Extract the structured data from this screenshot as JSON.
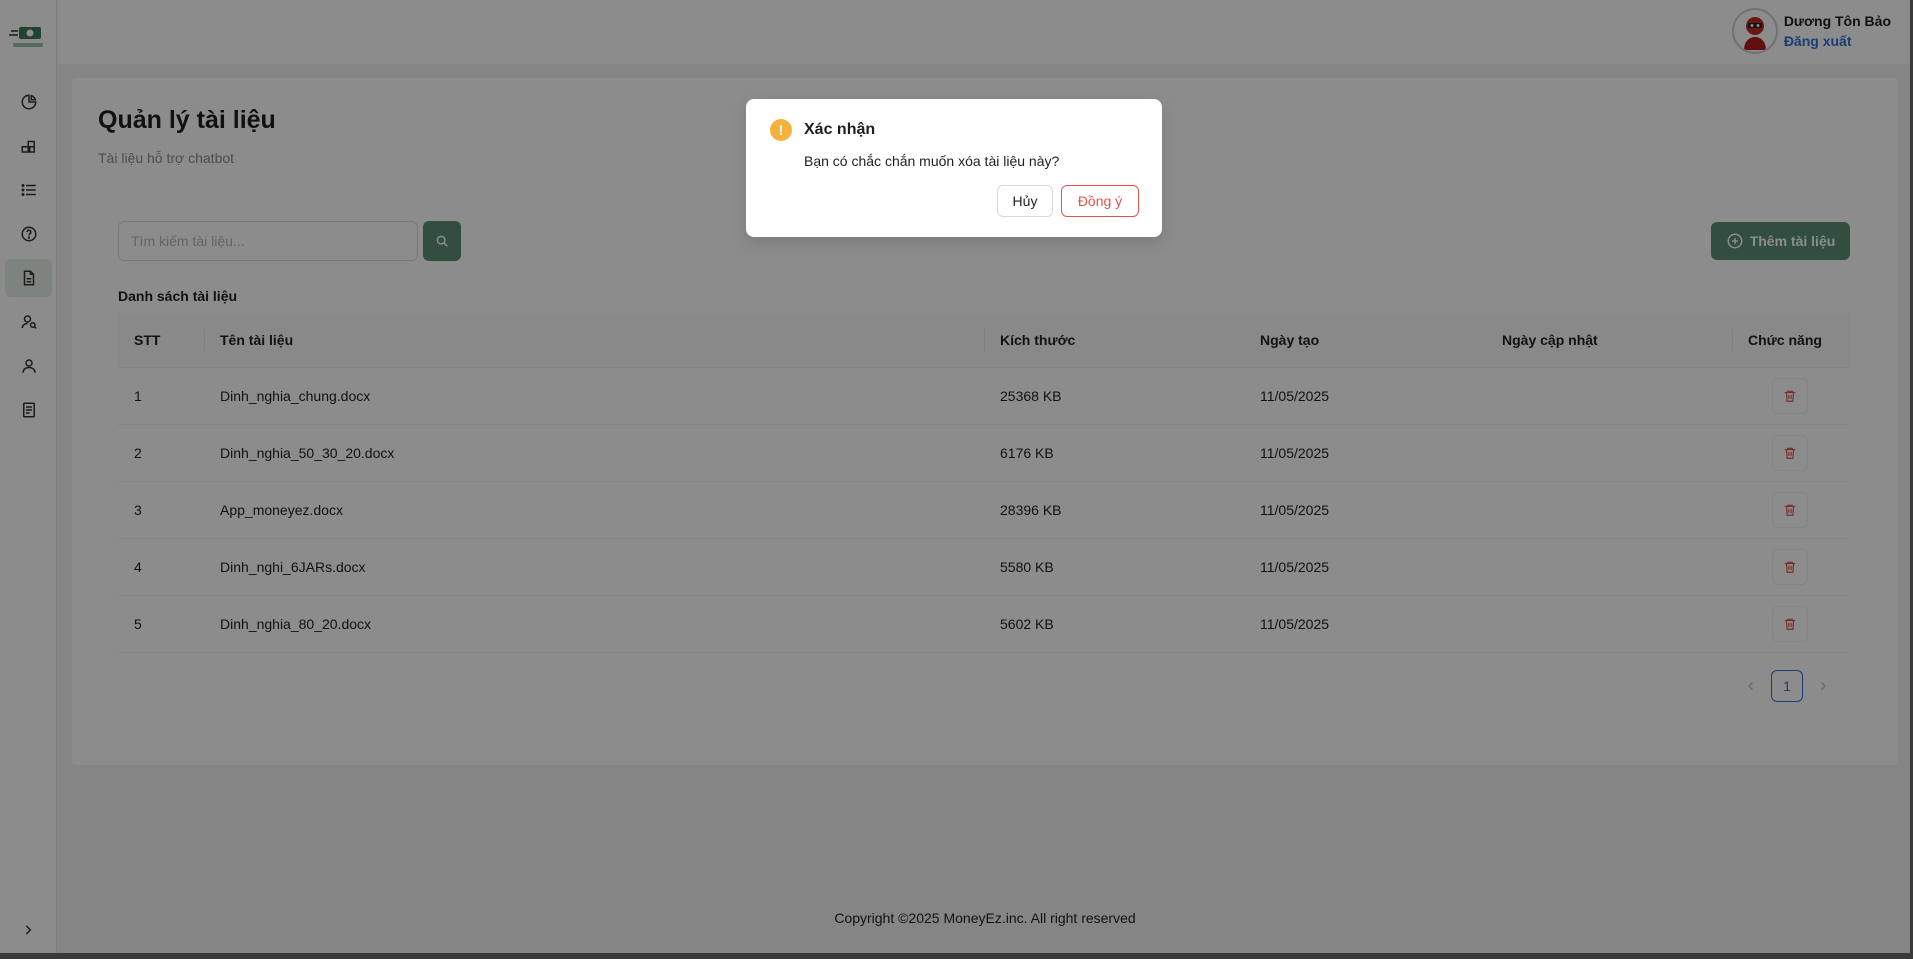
{
  "header": {
    "user_name": "Dương Tôn Bảo",
    "logout_label": "Đăng xuất"
  },
  "sidebar": {
    "items": [
      {
        "icon": "pie-chart-icon"
      },
      {
        "icon": "modules-icon"
      },
      {
        "icon": "list-icon"
      },
      {
        "icon": "help-circle-icon"
      },
      {
        "icon": "document-icon",
        "active": true
      },
      {
        "icon": "user-search-icon"
      },
      {
        "icon": "user-icon"
      },
      {
        "icon": "receipt-icon"
      }
    ]
  },
  "page": {
    "title": "Quản lý tài liệu",
    "subtitle": "Tài liệu hỗ trợ chatbot"
  },
  "toolbar": {
    "search_placeholder": "Tìm kiếm tài liệu...",
    "add_label": "Thêm tài liệu"
  },
  "list": {
    "title": "Danh sách tài liệu",
    "columns": [
      "STT",
      "Tên tài liệu",
      "Kích thước",
      "Ngày tạo",
      "Ngày cập nhật",
      "Chức năng"
    ],
    "rows": [
      {
        "stt": "1",
        "name": "Dinh_nghia_chung.docx",
        "size": "25368 KB",
        "created": "11/05/2025",
        "updated": ""
      },
      {
        "stt": "2",
        "name": "Dinh_nghia_50_30_20.docx",
        "size": "6176 KB",
        "created": "11/05/2025",
        "updated": ""
      },
      {
        "stt": "3",
        "name": "App_moneyez.docx",
        "size": "28396 KB",
        "created": "11/05/2025",
        "updated": ""
      },
      {
        "stt": "4",
        "name": "Dinh_nghi_6JARs.docx",
        "size": "5580 KB",
        "created": "11/05/2025",
        "updated": ""
      },
      {
        "stt": "5",
        "name": "Dinh_nghia_80_20.docx",
        "size": "5602 KB",
        "created": "11/05/2025",
        "updated": ""
      }
    ]
  },
  "pagination": {
    "current": "1"
  },
  "footer": {
    "text": "Copyright ©2025 MoneyEz.inc. All right reserved"
  },
  "modal": {
    "title": "Xác nhận",
    "message": "Bạn có chắc chắn muốn xóa tài liệu này?",
    "cancel_label": "Hủy",
    "ok_label": "Đồng ý"
  },
  "colors": {
    "primary": "#5b8f72",
    "danger": "#e0554b",
    "warning": "#f4b23c",
    "link": "#2f6fd6"
  }
}
